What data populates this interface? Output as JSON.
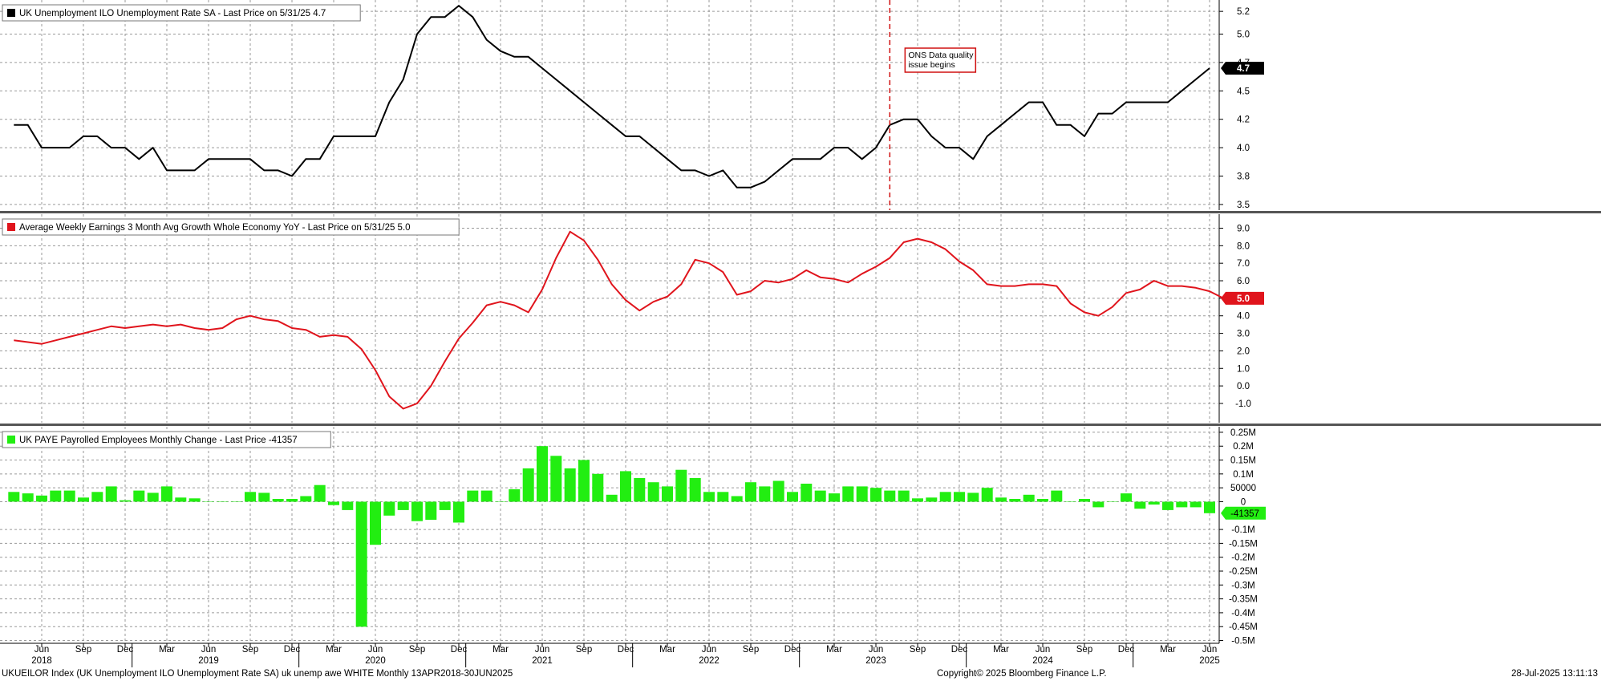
{
  "colors": {
    "panel1_line": "#000000",
    "panel2_line": "#e0141c",
    "panel3_bar": "#22ee11",
    "annotation": "#d01010",
    "grid": "#9a9a9a",
    "separator": "#555555"
  },
  "footer": {
    "left": "UKUEILOR Index (UK Unemployment ILO Unemployment Rate SA) uk unemp awe WHITE  Monthly 13APR2018-30JUN2025",
    "center": "Copyright© 2025 Bloomberg Finance L.P.",
    "right": "28-Jul-2025 13:11:13"
  },
  "chart_data": [
    {
      "type": "line",
      "legend": "UK Unemployment ILO Unemployment Rate SA - Last Price on 5/31/25 4.7",
      "last_value_label": "4.7",
      "y_ticks": [
        "5.2",
        "5.0",
        "4.7",
        "4.5",
        "4.2",
        "4.0",
        "3.8",
        "3.5"
      ],
      "y_tick_values": [
        5.2,
        5.0,
        4.75,
        4.5,
        4.25,
        4.0,
        3.75,
        3.5
      ],
      "ylim": [
        3.45,
        5.3
      ],
      "annotation": {
        "text": [
          "ONS Data quality",
          "issue begins"
        ],
        "x": "2023-07"
      },
      "series": [
        {
          "x_start": "2018-04",
          "values": [
            4.2,
            4.2,
            4.0,
            4.0,
            4.0,
            4.1,
            4.1,
            4.0,
            4.0,
            3.9,
            4.0,
            3.8,
            3.8,
            3.8,
            3.9,
            3.9,
            3.9,
            3.9,
            3.8,
            3.8,
            3.75,
            3.9,
            3.9,
            4.1,
            4.1,
            4.1,
            4.1,
            4.4,
            4.6,
            5.0,
            5.15,
            5.15,
            5.25,
            5.15,
            4.95,
            4.85,
            4.8,
            4.8,
            4.7,
            4.6,
            4.5,
            4.4,
            4.3,
            4.2,
            4.1,
            4.1,
            4.0,
            3.9,
            3.8,
            3.8,
            3.75,
            3.8,
            3.65,
            3.65,
            3.7,
            3.8,
            3.9,
            3.9,
            3.9,
            4.0,
            4.0,
            3.9,
            4.0,
            4.2,
            4.25,
            4.25,
            4.1,
            4.0,
            4.0,
            3.9,
            4.1,
            4.2,
            4.3,
            4.4,
            4.4,
            4.2,
            4.2,
            4.1,
            4.3,
            4.3,
            4.4,
            4.4,
            4.4,
            4.4,
            4.5,
            4.6,
            4.7
          ]
        }
      ]
    },
    {
      "type": "line",
      "legend": "Average Weekly Earnings 3 Month Avg Growth Whole Economy YoY - Last Price on 5/31/25 5.0",
      "last_value_label": "5.0",
      "y_ticks": [
        "9.0",
        "8.0",
        "7.0",
        "6.0",
        "5.0",
        "4.0",
        "3.0",
        "2.0",
        "1.0",
        "0.0",
        "-1.0"
      ],
      "y_tick_values": [
        9,
        8,
        7,
        6,
        5,
        4,
        3,
        2,
        1,
        0,
        -1
      ],
      "ylim": [
        -2.1,
        9.8
      ],
      "series": [
        {
          "x_start": "2018-04",
          "values": [
            2.6,
            2.5,
            2.4,
            2.6,
            2.8,
            3.0,
            3.2,
            3.4,
            3.3,
            3.4,
            3.5,
            3.4,
            3.5,
            3.3,
            3.2,
            3.3,
            3.8,
            4.0,
            3.8,
            3.7,
            3.3,
            3.2,
            2.8,
            2.9,
            2.8,
            2.1,
            0.9,
            -0.6,
            -1.3,
            -1.0,
            0.0,
            1.4,
            2.7,
            3.6,
            4.6,
            4.8,
            4.6,
            4.2,
            5.5,
            7.3,
            8.8,
            8.3,
            7.2,
            5.8,
            4.9,
            4.3,
            4.8,
            5.1,
            5.8,
            7.2,
            7.0,
            6.5,
            5.2,
            5.4,
            6.0,
            5.9,
            6.1,
            6.6,
            6.2,
            6.1,
            5.9,
            6.4,
            6.8,
            7.3,
            8.2,
            8.4,
            8.2,
            7.8,
            7.1,
            6.6,
            5.8,
            5.7,
            5.7,
            5.8,
            5.8,
            5.7,
            4.7,
            4.2,
            4.0,
            4.5,
            5.3,
            5.5,
            6.0,
            5.7,
            5.7,
            5.6,
            5.4,
            5.0
          ]
        }
      ]
    },
    {
      "type": "bar",
      "legend": "UK PAYE Payrolled Employees Monthly Change - Last Price -41357",
      "last_value_label": "-41357",
      "y_ticks": [
        "0.25M",
        "0.2M",
        "0.15M",
        "0.1M",
        "50000",
        "0",
        "-0.1M",
        "-0.15M",
        "-0.2M",
        "-0.25M",
        "-0.3M",
        "-0.35M",
        "-0.4M",
        "-0.45M",
        "-0.5M"
      ],
      "y_tick_values": [
        250000,
        200000,
        150000,
        100000,
        50000,
        0,
        -100000,
        -150000,
        -200000,
        -250000,
        -300000,
        -350000,
        -400000,
        -450000,
        -500000
      ],
      "ylim": [
        -510000,
        270000
      ],
      "series": [
        {
          "x_start": "2018-04",
          "values": [
            35000,
            30000,
            22000,
            40000,
            40000,
            15000,
            35000,
            55000,
            5000,
            40000,
            32000,
            55000,
            15000,
            12000,
            0,
            0,
            0,
            35000,
            32000,
            10000,
            10000,
            20000,
            60000,
            -12000,
            -30000,
            -450000,
            -155000,
            -50000,
            -30000,
            -70000,
            -65000,
            -30000,
            -75000,
            40000,
            40000,
            0,
            45000,
            120000,
            200000,
            165000,
            120000,
            150000,
            100000,
            25000,
            110000,
            85000,
            70000,
            55000,
            115000,
            85000,
            35000,
            35000,
            20000,
            70000,
            55000,
            75000,
            35000,
            65000,
            40000,
            30000,
            55000,
            55000,
            50000,
            40000,
            40000,
            12000,
            15000,
            35000,
            35000,
            32000,
            50000,
            15000,
            10000,
            25000,
            10000,
            40000,
            0,
            10000,
            -20000,
            0,
            30000,
            -25000,
            -10000,
            -30000,
            -20000,
            -20000,
            -41357
          ]
        }
      ]
    }
  ],
  "x_axis": {
    "minor": [
      {
        "label": "Jun",
        "month": "2018-06"
      },
      {
        "label": "Sep",
        "month": "2018-09"
      },
      {
        "label": "Dec",
        "month": "2018-12"
      },
      {
        "label": "Mar",
        "month": "2019-03"
      },
      {
        "label": "Jun",
        "month": "2019-06"
      },
      {
        "label": "Sep",
        "month": "2019-09"
      },
      {
        "label": "Dec",
        "month": "2019-12"
      },
      {
        "label": "Mar",
        "month": "2020-03"
      },
      {
        "label": "Jun",
        "month": "2020-06"
      },
      {
        "label": "Sep",
        "month": "2020-09"
      },
      {
        "label": "Dec",
        "month": "2020-12"
      },
      {
        "label": "Mar",
        "month": "2021-03"
      },
      {
        "label": "Jun",
        "month": "2021-06"
      },
      {
        "label": "Sep",
        "month": "2021-09"
      },
      {
        "label": "Dec",
        "month": "2021-12"
      },
      {
        "label": "Mar",
        "month": "2022-03"
      },
      {
        "label": "Jun",
        "month": "2022-06"
      },
      {
        "label": "Sep",
        "month": "2022-09"
      },
      {
        "label": "Dec",
        "month": "2022-12"
      },
      {
        "label": "Mar",
        "month": "2023-03"
      },
      {
        "label": "Jun",
        "month": "2023-06"
      },
      {
        "label": "Sep",
        "month": "2023-09"
      },
      {
        "label": "Dec",
        "month": "2023-12"
      },
      {
        "label": "Mar",
        "month": "2024-03"
      },
      {
        "label": "Jun",
        "month": "2024-06"
      },
      {
        "label": "Sep",
        "month": "2024-09"
      },
      {
        "label": "Dec",
        "month": "2024-12"
      },
      {
        "label": "Mar",
        "month": "2025-03"
      },
      {
        "label": "Jun",
        "month": "2025-06"
      }
    ],
    "years": [
      {
        "label": "2018",
        "month": "2018-06"
      },
      {
        "label": "2019",
        "month": "2019-06"
      },
      {
        "label": "2020",
        "month": "2020-06"
      },
      {
        "label": "2021",
        "month": "2021-06"
      },
      {
        "label": "2022",
        "month": "2022-06"
      },
      {
        "label": "2023",
        "month": "2023-06"
      },
      {
        "label": "2024",
        "month": "2024-06"
      },
      {
        "label": "2025",
        "month": "2025-06"
      }
    ]
  }
}
